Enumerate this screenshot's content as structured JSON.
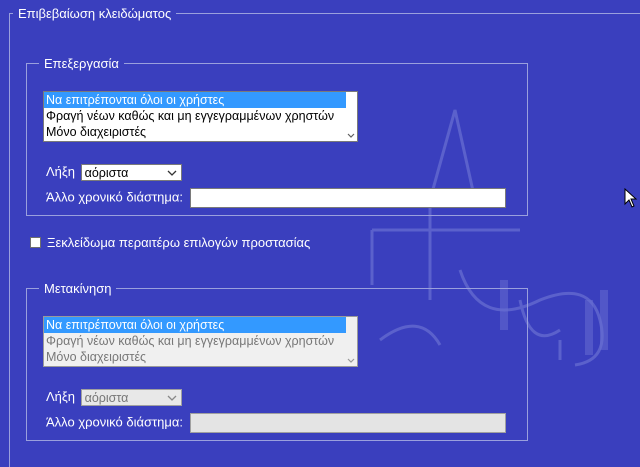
{
  "outer": {
    "legend": "Επιβεβαίωση κλειδώματος"
  },
  "edit": {
    "legend": "Επεξεργασία",
    "options": [
      "Να επιτρέπονται όλοι οι χρήστες",
      "Φραγή νέων καθώς και μη εγγεγραμμένων χρηστών",
      "Μόνο διαχειριστές"
    ],
    "selected_index": 0,
    "expiry_label": "Λήξη",
    "expiry_value": "αόριστα",
    "other_label": "Άλλο χρονικό διάστημα:",
    "other_value": ""
  },
  "unlock": {
    "label": "Ξεκλείδωμα περαιτέρω επιλογών προστασίας",
    "checked": false
  },
  "move": {
    "legend": "Μετακίνηση",
    "options": [
      "Να επιτρέπονται όλοι οι χρήστες",
      "Φραγή νέων καθώς και μη εγγεγραμμένων χρηστών",
      "Μόνο διαχειριστές"
    ],
    "selected_index": 0,
    "expiry_label": "Λήξη",
    "expiry_value": "αόριστα",
    "other_label": "Άλλο χρονικό διάστημα:",
    "other_value": ""
  },
  "colors": {
    "background": "#3a3fbe",
    "selection": "#3399ff",
    "border": "#9aa0dd"
  }
}
